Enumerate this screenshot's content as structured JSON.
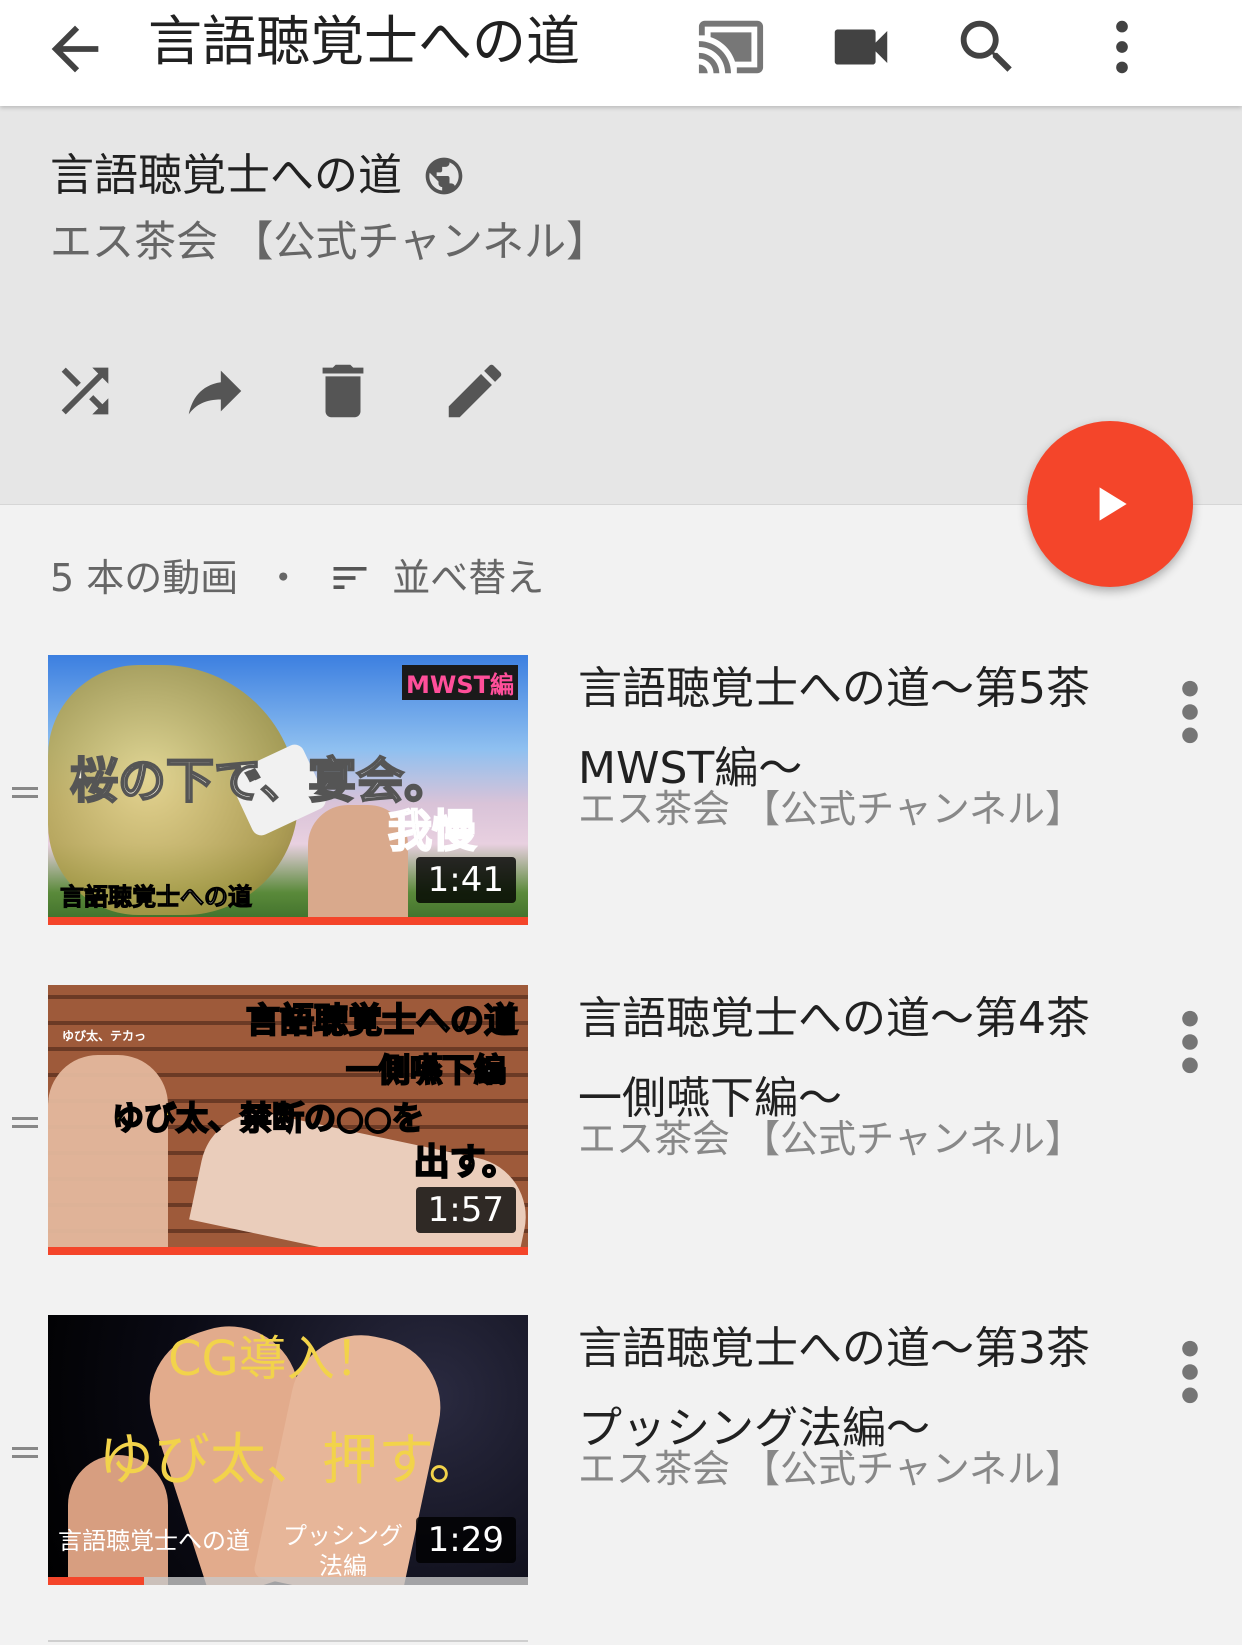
{
  "appbar": {
    "title": "言語聴覚士への道",
    "icons": [
      "back-arrow-icon",
      "cast-icon",
      "video-camera-icon",
      "search-icon",
      "more-vert-icon"
    ]
  },
  "playlist": {
    "title": "言語聴覚士への道",
    "privacy_icon": "globe-icon",
    "owner": "エス茶会 【公式チャンネル】",
    "actions": [
      "shuffle-icon",
      "share-icon",
      "delete-icon",
      "edit-icon"
    ],
    "play_all_icon": "play-icon"
  },
  "meta": {
    "count": "5 本の動画",
    "separator": "・",
    "sort_label": "並べ替え"
  },
  "colors": {
    "accent": "#f4452a",
    "header_bg": "#e6e6e6",
    "page_bg": "#f2f2f2"
  },
  "videos": [
    {
      "title": "言語聴覚士への道〜第5茶 MWST編〜",
      "owner": "エス茶会 【公式チャンネル】",
      "duration": "1:41",
      "progress": 1.0,
      "thumb_texts": [
        "MWST編",
        "桜の下で、宴会。",
        "我慢",
        "言語聴覚士への道"
      ]
    },
    {
      "title": "言語聴覚士への道〜第4茶 一側嚥下編〜",
      "owner": "エス茶会 【公式チャンネル】",
      "duration": "1:57",
      "progress": 1.0,
      "thumb_texts": [
        "言語聴覚士への道",
        "ゆび太、テカっ",
        "一側嚥下編",
        "ゆび太、禁断の○○を",
        "出す。"
      ]
    },
    {
      "title": "言語聴覚士への道〜第3茶 プッシング法編〜",
      "owner": "エス茶会 【公式チャンネル】",
      "duration": "1:29",
      "progress": 0.2,
      "thumb_texts": [
        "CG導入！",
        "ゆび太、押す。",
        "言語聴覚士への道",
        "プッシング法編"
      ]
    }
  ]
}
